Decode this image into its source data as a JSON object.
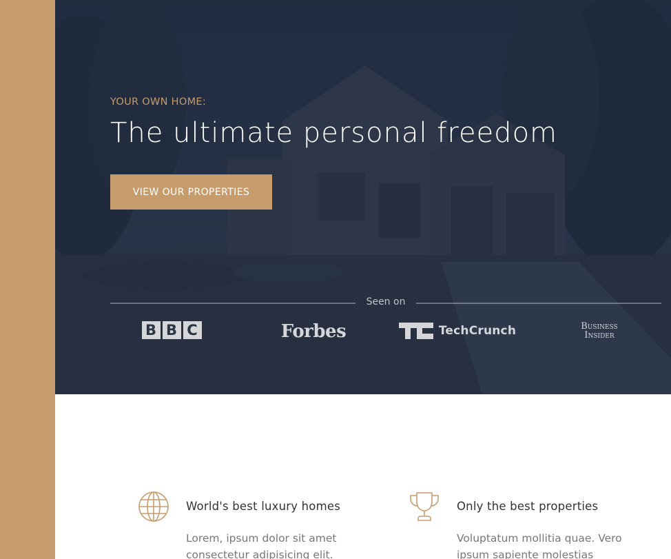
{
  "colors": {
    "accent": "#c69c6d",
    "hero_overlay": "#222d41",
    "white": "#ffffff",
    "text_dark": "#333333",
    "text_muted": "#777777"
  },
  "hero": {
    "subtitle": "YOUR OWN HOME:",
    "headline": "The ultimate personal freedom",
    "cta_label": "VIEW OUR PROPERTIES"
  },
  "press": {
    "label": "Seen on",
    "logos": [
      {
        "name": "BBC",
        "letters": [
          "B",
          "B",
          "C"
        ]
      },
      {
        "name": "Forbes"
      },
      {
        "name": "TechCrunch"
      },
      {
        "name": "Business Insider",
        "lines": [
          "Business",
          "Insider"
        ]
      }
    ]
  },
  "features": [
    {
      "icon": "globe-icon",
      "title": "World's best luxury homes",
      "text": "Lorem, ipsum dolor sit amet consectetur adipisicing elit. Tenetur"
    },
    {
      "icon": "trophy-icon",
      "title": "Only the best properties",
      "text": "Voluptatum mollitia quae. Vero ipsum sapiente molestias"
    }
  ]
}
